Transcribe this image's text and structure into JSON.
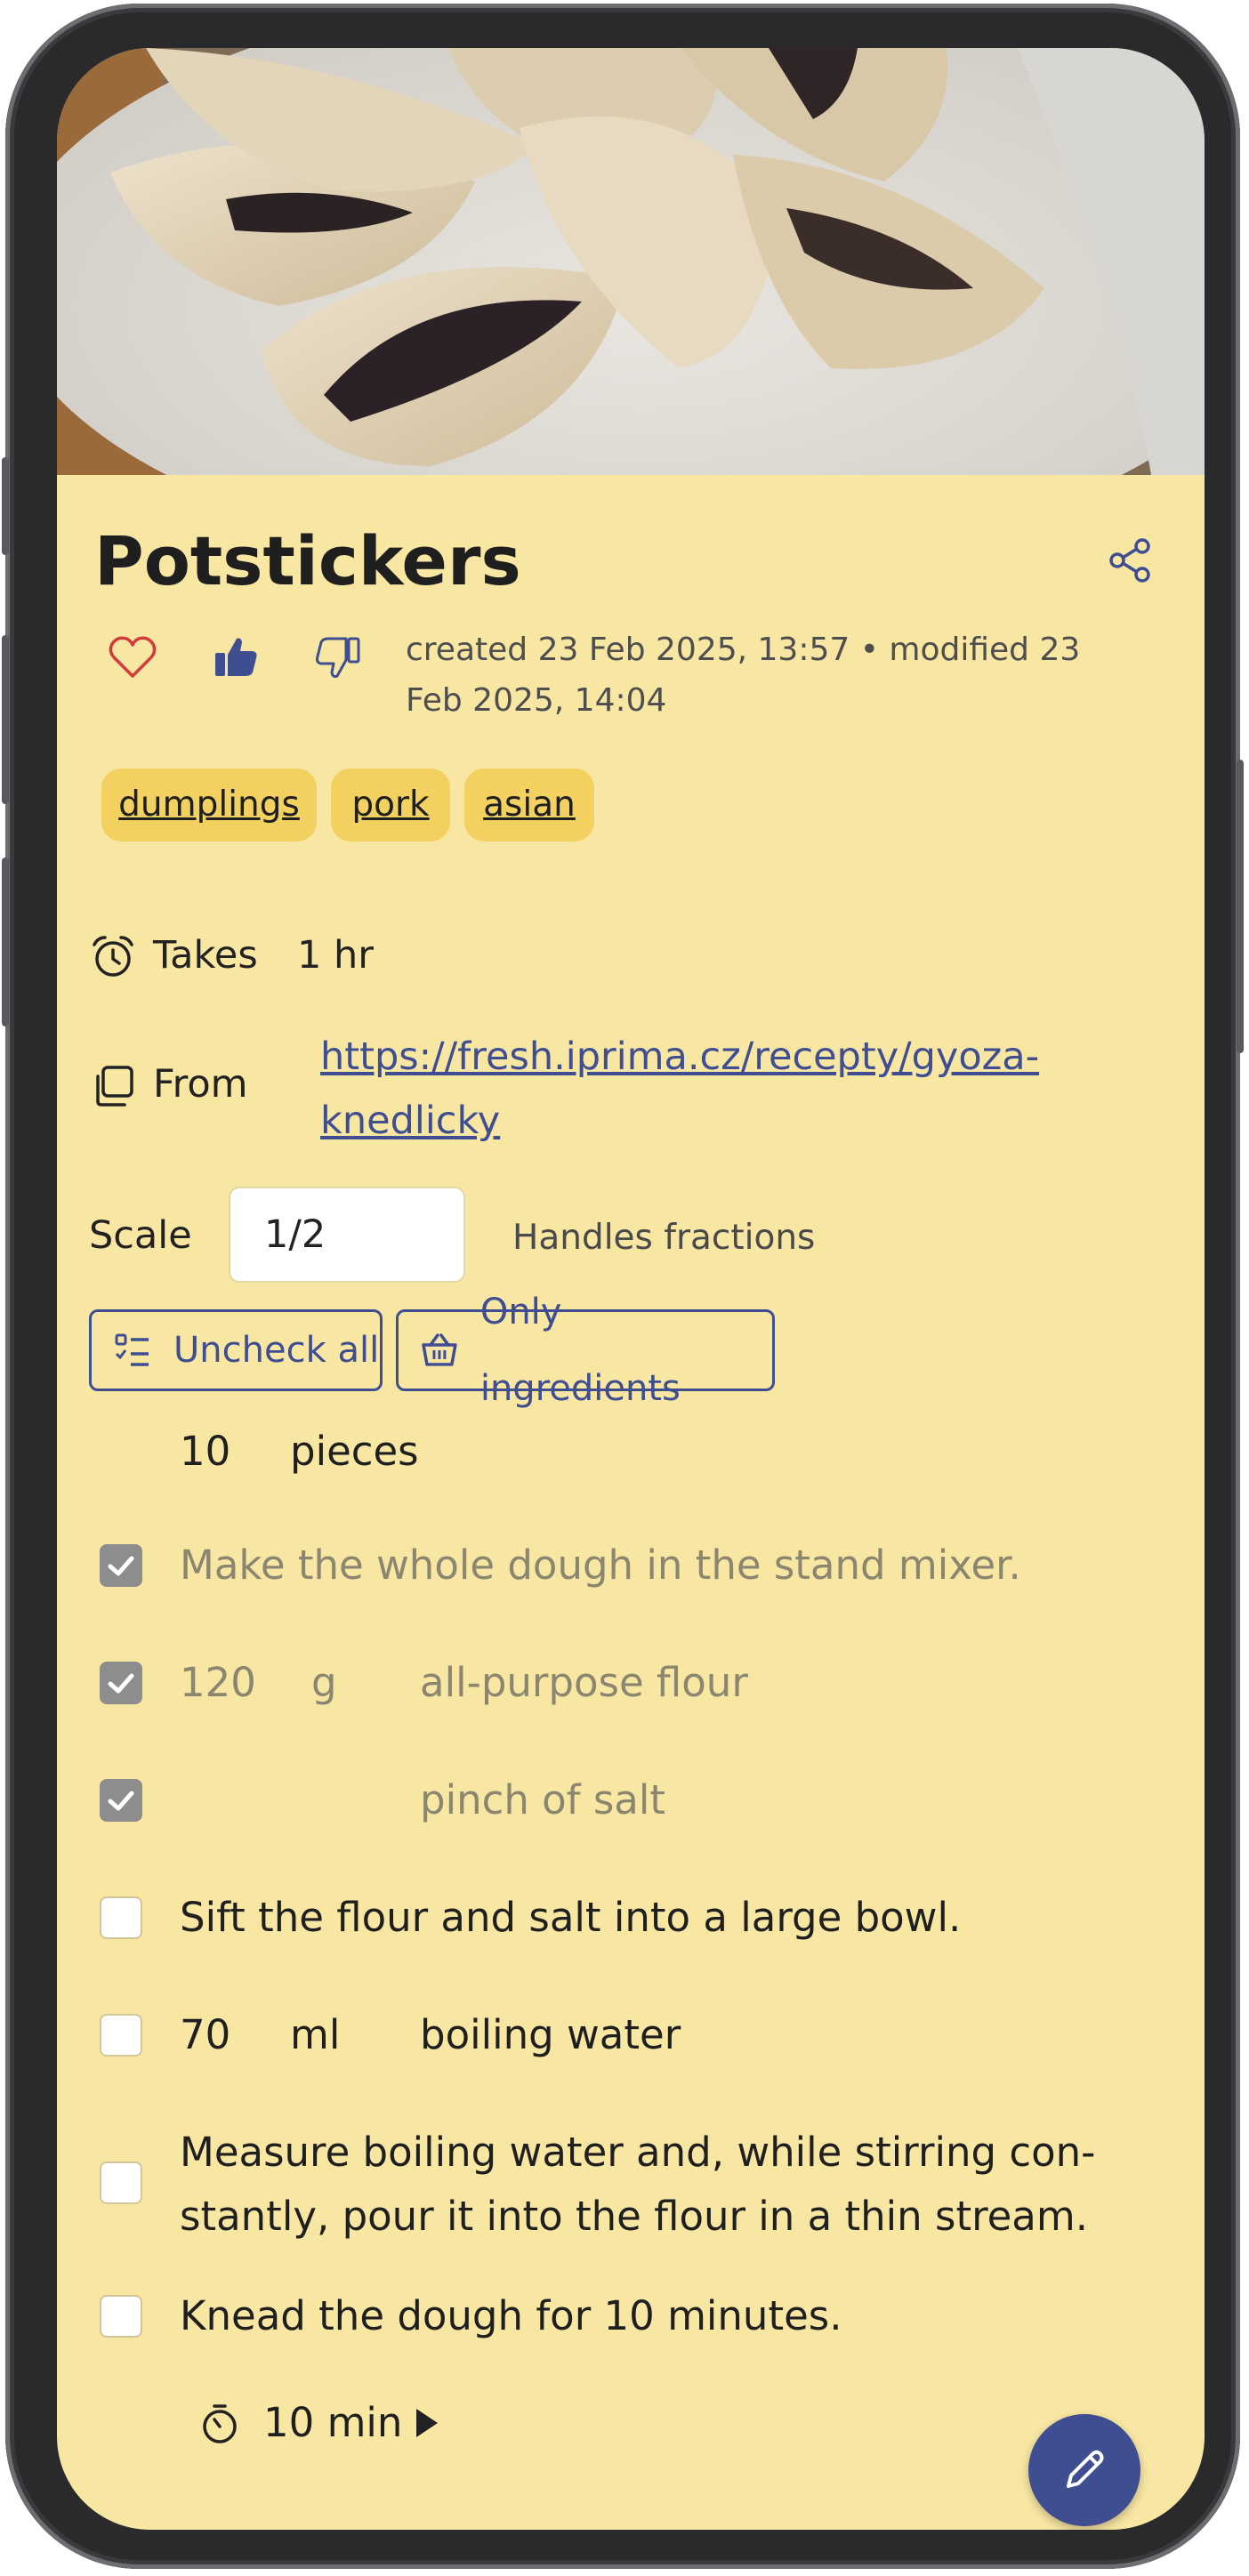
{
  "recipe": {
    "title": "Potstickers",
    "meta": "created 23 Feb 2025, 13:57 • modified 23 Feb 2025, 14:04",
    "tags": [
      "dumplings",
      "pork",
      "asian"
    ]
  },
  "info": {
    "takes_label": "Takes",
    "takes_value": "1 hr",
    "from_label": "From",
    "from_url_line1": "https://fresh.iprima.cz/recepty/gyoza-",
    "from_url_line2": "knedlicky"
  },
  "scale": {
    "label": "Scale",
    "value": "1/2",
    "hint": "Handles fractions"
  },
  "buttons": {
    "uncheck_all": "Uncheck all",
    "only_ingredients": "Only ingredients"
  },
  "yield": {
    "amount": "10",
    "unit": "pieces"
  },
  "steps": [
    {
      "type": "instruction",
      "checked": true,
      "text": "Make the whole dough in the stand mixer."
    },
    {
      "type": "ingredient",
      "checked": true,
      "amount": "120",
      "unit": "g",
      "name": "all-purpose flour"
    },
    {
      "type": "ingredient",
      "checked": true,
      "amount": "",
      "unit": "",
      "name": "pinch of salt"
    },
    {
      "type": "instruction",
      "checked": false,
      "text": "Sift the flour and salt into a large bowl."
    },
    {
      "type": "ingredient",
      "checked": false,
      "amount": "70",
      "unit": "ml",
      "name": "boiling water"
    },
    {
      "type": "instruction",
      "checked": false,
      "text_line1": "Measure boiling water and, while stirring con-",
      "text_line2": "stantly, pour it into the flour in a thin stream."
    },
    {
      "type": "instruction",
      "checked": false,
      "text": "Knead the dough for 10 minutes."
    }
  ],
  "timer": {
    "value": "10 min"
  },
  "icons": {
    "share": "share-icon",
    "favorite": "heart-icon",
    "like": "thumbs-up-icon",
    "dislike": "thumbs-down-icon",
    "clock": "alarm-clock-icon",
    "source": "copy-icon",
    "uncheck": "checklist-icon",
    "basket": "basket-icon",
    "timer": "timer-icon",
    "play": "play-icon",
    "edit": "pencil-icon"
  },
  "colors": {
    "background": "#f8e6a3",
    "tag": "#f3d161",
    "accent": "#3f4d91",
    "heart": "#d23b3b",
    "checked_box": "#8d8d8d"
  }
}
